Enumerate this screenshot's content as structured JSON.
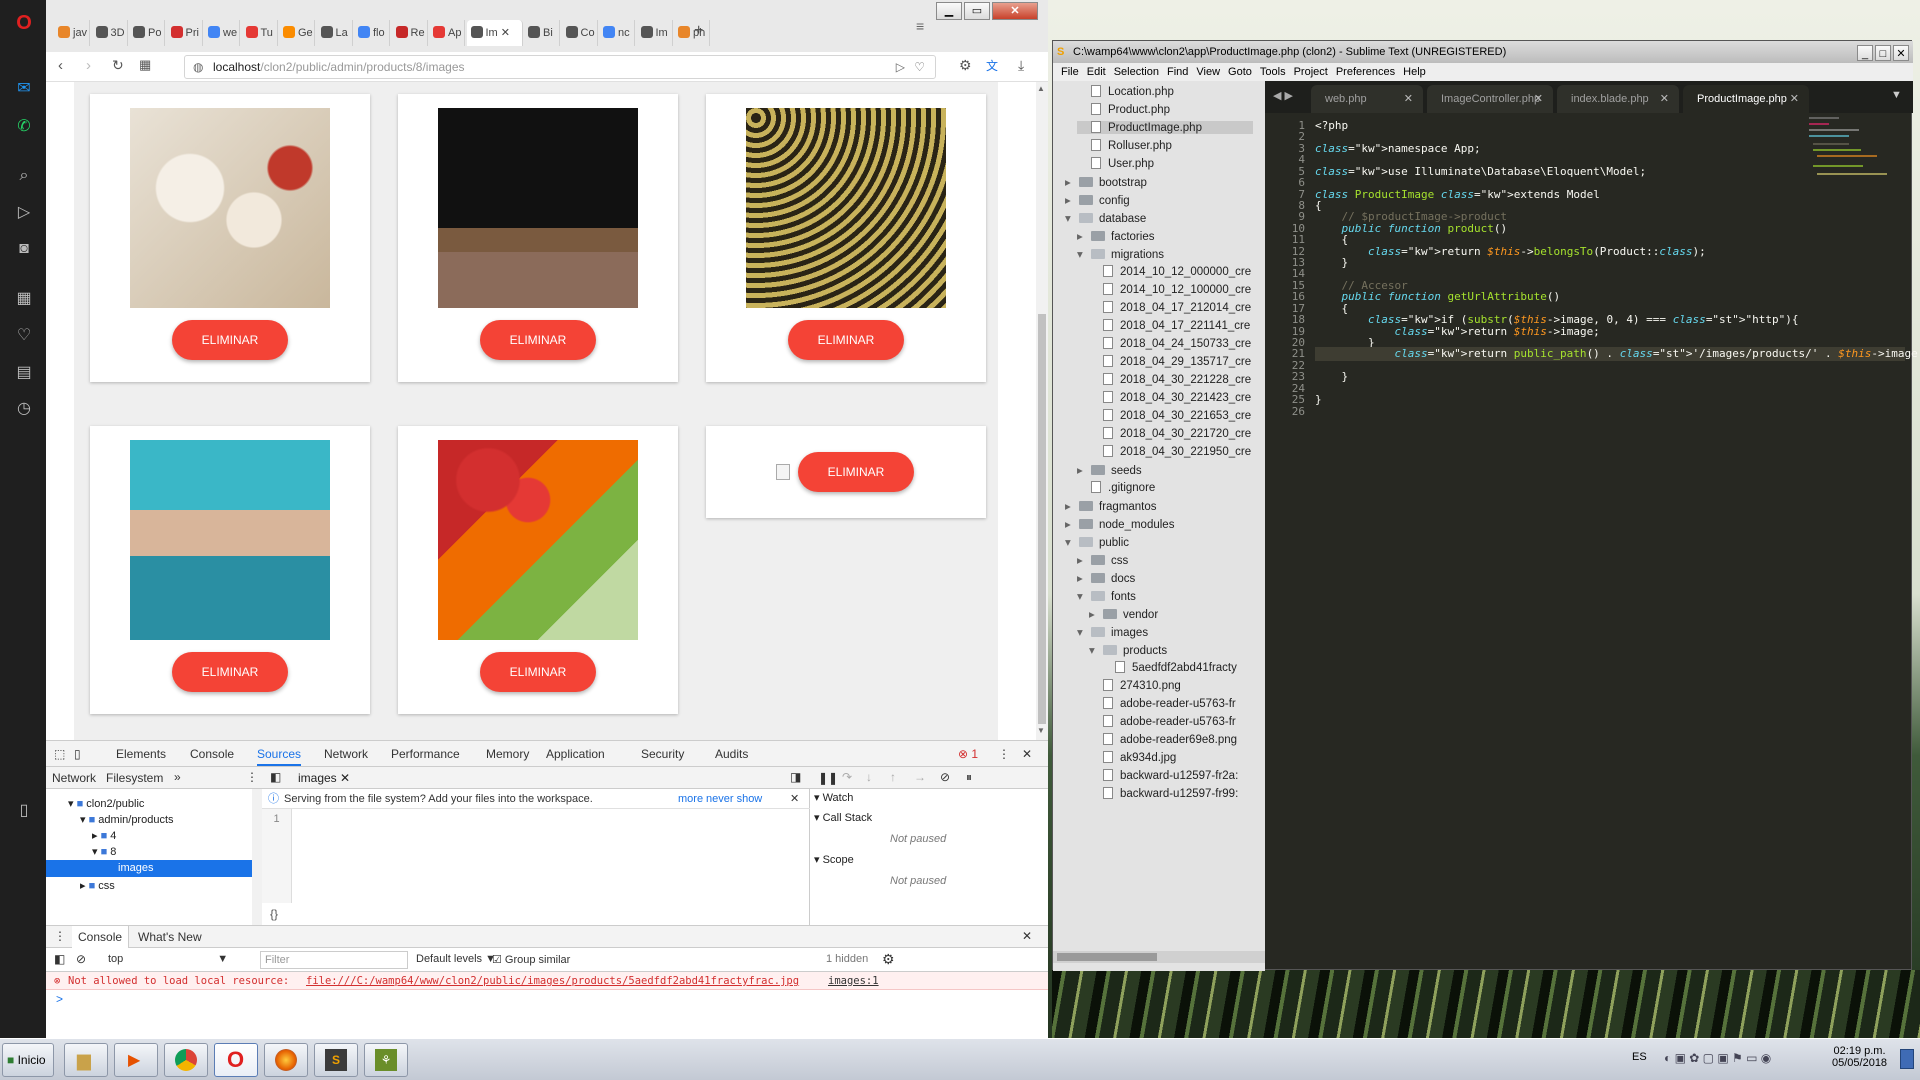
{
  "browser": {
    "tabs": [
      {
        "label": "jav",
        "color": "#e8862a"
      },
      {
        "label": "3D",
        "color": "#555555"
      },
      {
        "label": "Po",
        "color": "#555555"
      },
      {
        "label": "Pri",
        "color": "#d32f2f"
      },
      {
        "label": "we",
        "color": "#4285f4"
      },
      {
        "label": "Tu",
        "color": "#e53935"
      },
      {
        "label": "Ge",
        "color": "#fb8c00"
      },
      {
        "label": "La",
        "color": "#555555"
      },
      {
        "label": "flo",
        "color": "#4285f4"
      },
      {
        "label": "Re",
        "color": "#c62828"
      },
      {
        "label": "Ap",
        "color": "#e53935"
      },
      {
        "label": "Im",
        "color": "#555555"
      },
      {
        "label": "Bi",
        "color": "#555555"
      },
      {
        "label": "Co",
        "color": "#555555"
      },
      {
        "label": "nc",
        "color": "#4285f4"
      },
      {
        "label": "Im",
        "color": "#555555"
      },
      {
        "label": "ph",
        "color": "#e8862a"
      }
    ],
    "active_tab": 11,
    "url_host": "localhost",
    "url_path": "/clon2/public/admin/products/8/images",
    "new_tab": "+"
  },
  "page": {
    "delete_label": "ELIMINAR"
  },
  "devtools": {
    "tabs": [
      "Elements",
      "Console",
      "Sources",
      "Network",
      "Performance",
      "Memory",
      "Application",
      "Security",
      "Audits"
    ],
    "active_tab": "Sources",
    "error_count": "1",
    "nav_tabs": [
      "Network",
      "Filesystem"
    ],
    "file_tab": "images",
    "info": "Serving from the file system? Add your files into the workspace.",
    "info_more": "more",
    "info_never": "never show",
    "tree": [
      "clon2/public",
      "admin/products",
      "4",
      "8",
      "images",
      "css"
    ],
    "line_number": "1",
    "braces": "{}",
    "debug_sections": [
      {
        "title": "Watch",
        "body": ""
      },
      {
        "title": "Call Stack",
        "body": "Not paused"
      },
      {
        "title": "Scope",
        "body": "Not paused"
      }
    ],
    "drawer_tabs": [
      "Console",
      "What's New"
    ],
    "context": "top",
    "filter_placeholder": "Filter",
    "levels": "Default levels",
    "group_similar": "Group similar",
    "hidden": "1 hidden",
    "error_message": "Not allowed to load local resource:",
    "error_url": "file:///C:/wamp64/www/clon2/public/images/products/5aedfdf2abd41fractyfrac.jpg",
    "error_source": "images:1",
    "prompt": ">"
  },
  "sublime": {
    "title": "C:\\wamp64\\www\\clon2\\app\\ProductImage.php (clon2) - Sublime Text (UNREGISTERED)",
    "menu": [
      "File",
      "Edit",
      "Selection",
      "Find",
      "View",
      "Goto",
      "Tools",
      "Project",
      "Preferences",
      "Help"
    ],
    "tabs": [
      "web.php",
      "ImageController.php",
      "index.blade.php",
      "ProductImage.php"
    ],
    "active_tab": 3,
    "sidebar": [
      {
        "label": "Location.php",
        "type": "file",
        "indent": 2
      },
      {
        "label": "Product.php",
        "type": "file",
        "indent": 2
      },
      {
        "label": "ProductImage.php",
        "type": "file",
        "indent": 2,
        "selected": true
      },
      {
        "label": "Rolluser.php",
        "type": "file",
        "indent": 2
      },
      {
        "label": "User.php",
        "type": "file",
        "indent": 2
      },
      {
        "label": "bootstrap",
        "type": "folder",
        "indent": 1
      },
      {
        "label": "config",
        "type": "folder",
        "indent": 1
      },
      {
        "label": "database",
        "type": "folder-open",
        "indent": 1
      },
      {
        "label": "factories",
        "type": "folder",
        "indent": 2
      },
      {
        "label": "migrations",
        "type": "folder-open",
        "indent": 2
      },
      {
        "label": "2014_10_12_000000_cre",
        "type": "file",
        "indent": 3
      },
      {
        "label": "2014_10_12_100000_cre",
        "type": "file",
        "indent": 3
      },
      {
        "label": "2018_04_17_212014_cre",
        "type": "file",
        "indent": 3
      },
      {
        "label": "2018_04_17_221141_cre",
        "type": "file",
        "indent": 3
      },
      {
        "label": "2018_04_24_150733_cre",
        "type": "file",
        "indent": 3
      },
      {
        "label": "2018_04_29_135717_cre",
        "type": "file",
        "indent": 3
      },
      {
        "label": "2018_04_30_221228_cre",
        "type": "file",
        "indent": 3
      },
      {
        "label": "2018_04_30_221423_cre",
        "type": "file",
        "indent": 3
      },
      {
        "label": "2018_04_30_221653_cre",
        "type": "file",
        "indent": 3
      },
      {
        "label": "2018_04_30_221720_cre",
        "type": "file",
        "indent": 3
      },
      {
        "label": "2018_04_30_221950_cre",
        "type": "file",
        "indent": 3
      },
      {
        "label": "seeds",
        "type": "folder",
        "indent": 2
      },
      {
        "label": ".gitignore",
        "type": "file",
        "indent": 2
      },
      {
        "label": "fragmantos",
        "type": "folder",
        "indent": 1
      },
      {
        "label": "node_modules",
        "type": "folder",
        "indent": 1
      },
      {
        "label": "public",
        "type": "folder-open",
        "indent": 1
      },
      {
        "label": "css",
        "type": "folder",
        "indent": 2
      },
      {
        "label": "docs",
        "type": "folder",
        "indent": 2
      },
      {
        "label": "fonts",
        "type": "folder-open",
        "indent": 2
      },
      {
        "label": "vendor",
        "type": "folder",
        "indent": 3
      },
      {
        "label": "images",
        "type": "folder-open",
        "indent": 2
      },
      {
        "label": "products",
        "type": "folder-open",
        "indent": 3
      },
      {
        "label": "5aedfdf2abd41fracty",
        "type": "file",
        "indent": 4
      },
      {
        "label": "274310.png",
        "type": "file",
        "indent": 3
      },
      {
        "label": "adobe-reader-u5763-fr",
        "type": "file",
        "indent": 3
      },
      {
        "label": "adobe-reader-u5763-fr",
        "type": "file",
        "indent": 3
      },
      {
        "label": "adobe-reader69e8.png",
        "type": "file",
        "indent": 3
      },
      {
        "label": "ak934d.jpg",
        "type": "file",
        "indent": 3
      },
      {
        "label": "backward-u12597-fr2a:",
        "type": "file",
        "indent": 3
      },
      {
        "label": "backward-u12597-fr99:",
        "type": "file",
        "indent": 3
      }
    ],
    "code": [
      "<?php",
      "",
      "namespace App;",
      "",
      "use Illuminate\\Database\\Eloquent\\Model;",
      "",
      "class ProductImage extends Model",
      "{",
      "    // $productImage->product",
      "    public function product()",
      "    {",
      "        return $this->belongsTo(Product::class);",
      "    }",
      "",
      "    // Accesor",
      "    public function getUrlAttribute()",
      "    {",
      "        if (substr($this->image, 0, 4) === \"http\"){",
      "            return $this->image;",
      "        }",
      "            return public_path() . '/images/products/' . $this->image;",
      "",
      "    }",
      "",
      "}",
      ""
    ]
  },
  "taskbar": {
    "start": "Inicio",
    "lang": "ES",
    "time": "02:19 p.m.",
    "date": "05/05/2018"
  }
}
